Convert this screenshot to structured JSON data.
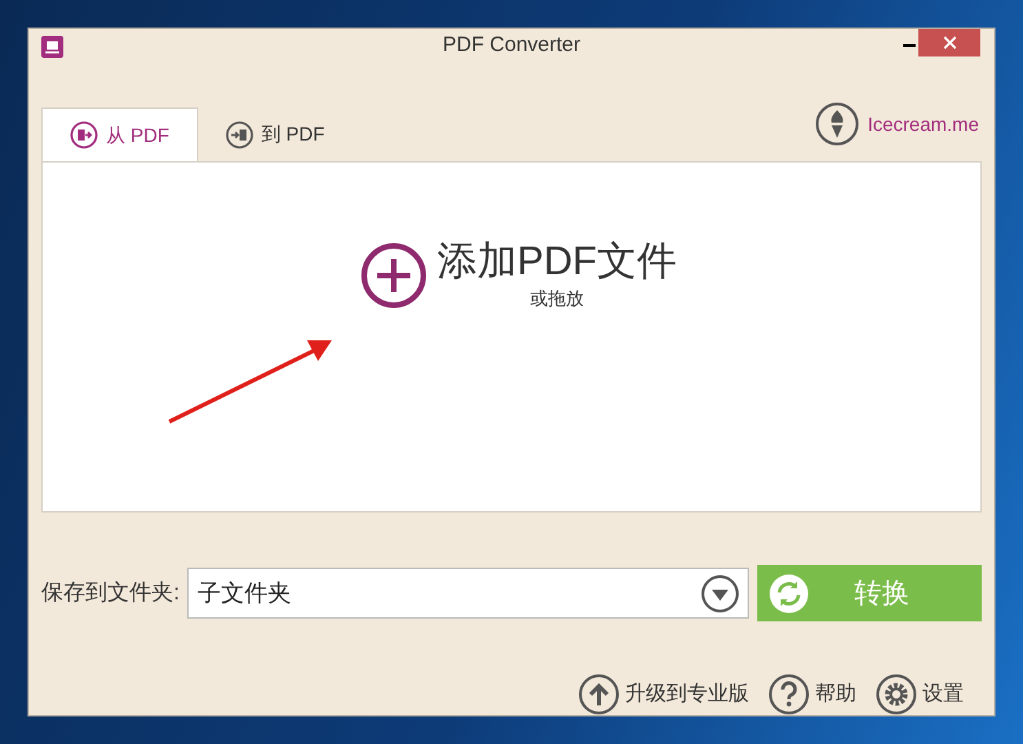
{
  "window": {
    "title": "PDF Converter"
  },
  "tabs": [
    {
      "label": "从 PDF",
      "kind": "from",
      "selected": true
    },
    {
      "label": "到 PDF",
      "kind": "to",
      "selected": false
    }
  ],
  "brand_link": "Icecream.me",
  "drop_zone": {
    "title": "添加PDF文件",
    "subtitle": "或拖放"
  },
  "save_folder": {
    "label": "保存到文件夹:",
    "value": "子文件夹"
  },
  "convert_button": "转换",
  "footer_links": [
    {
      "label": "升级到专业版",
      "kind": "upgrade"
    },
    {
      "label": "帮助",
      "kind": "help"
    },
    {
      "label": "设置",
      "kind": "settings"
    }
  ]
}
